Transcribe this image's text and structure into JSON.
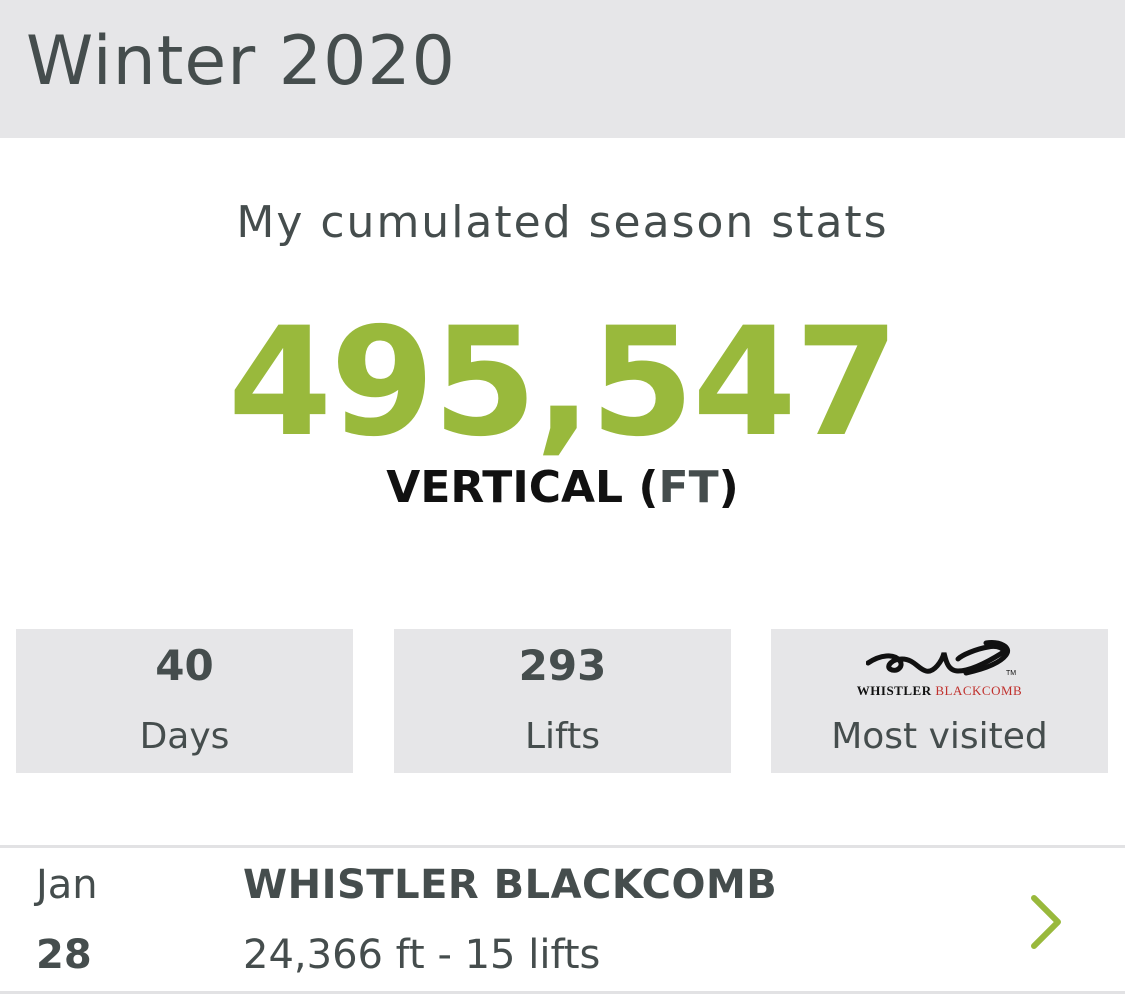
{
  "header": {
    "title": "Winter 2020"
  },
  "summary": {
    "subtitle": "My cumulated season stats",
    "vertical_value": "495,547",
    "vertical_label_prefix": "VERTICAL (",
    "vertical_label_unit": "FT",
    "vertical_label_suffix": ")"
  },
  "stats": [
    {
      "value": "40",
      "label": "Days"
    },
    {
      "value": "293",
      "label": "Lifts"
    },
    {
      "logo_text_primary": "WHISTLER",
      "logo_text_accent": "BLACKCOMB",
      "label": "Most visited",
      "logo_icon": "whistler-blackcomb-logo"
    }
  ],
  "colors": {
    "accent_green": "#99b93c",
    "text_dark": "#454d4d",
    "panel_gray": "#e6e6e8",
    "logo_red": "#c0302c"
  },
  "visits": [
    {
      "month": "Jan",
      "day": "28",
      "resort": "WHISTLER BLACKCOMB",
      "detail": "24,366 ft - 15 lifts",
      "icon": "chevron-right-icon"
    }
  ]
}
